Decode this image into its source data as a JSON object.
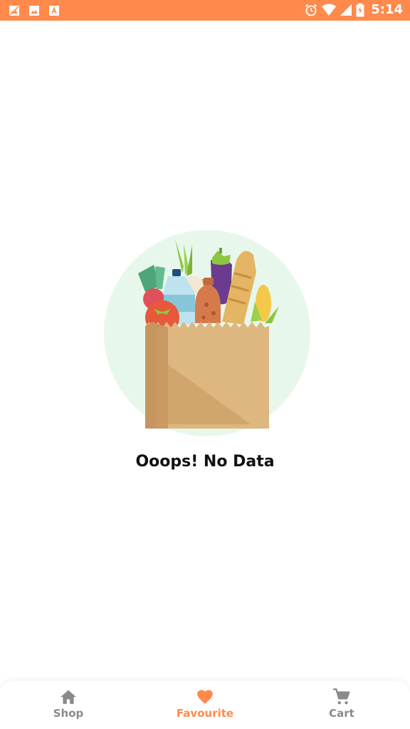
{
  "status_bar": {
    "time": "5:14",
    "left_icons": [
      "image-crossed-icon",
      "image-icon",
      "font-a-icon"
    ],
    "right_icons": [
      "alarm-icon",
      "wifi-icon",
      "signal-icon",
      "battery-icon"
    ],
    "background_color": "#FF8A4C"
  },
  "main": {
    "illustration": "grocery-bag-illustration",
    "empty_message": "Ooops! No Data"
  },
  "bottom_nav": {
    "items": [
      {
        "label": "Shop",
        "icon": "home-icon",
        "active": false
      },
      {
        "label": "Favourite",
        "icon": "heart-icon",
        "active": true
      },
      {
        "label": "Cart",
        "icon": "cart-icon",
        "active": false
      }
    ],
    "active_color": "#FF8A4C",
    "inactive_color": "#8A8A8A"
  }
}
